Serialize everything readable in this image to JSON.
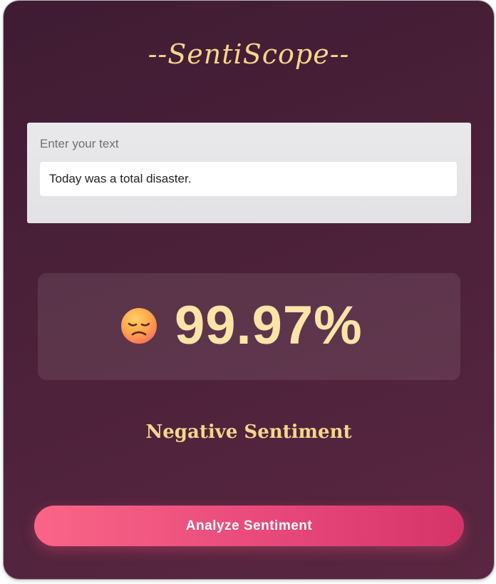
{
  "app": {
    "title": "--SentiScope--"
  },
  "input": {
    "label": "Enter your text",
    "value": "Today was a total disaster."
  },
  "result": {
    "emoji_icon": "disappointed-face-icon",
    "percentage": "99.97%",
    "sentiment": "Negative Sentiment"
  },
  "actions": {
    "analyze_label": "Analyze Sentiment"
  },
  "colors": {
    "title_gold": "#f7d58c",
    "percent_cream": "#fbe4a8",
    "card_bg": "#4b2139",
    "button_pink": "#e6467a"
  }
}
